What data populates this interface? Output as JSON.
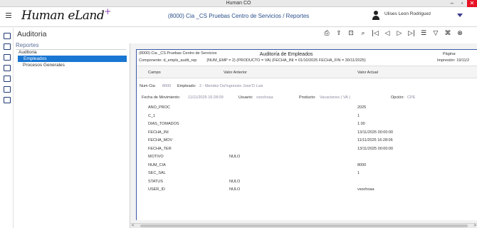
{
  "window": {
    "title": "Human CO",
    "min": "–",
    "max": "▫",
    "close": "✕"
  },
  "header": {
    "logo": "Human eLand",
    "logo_plus": "+",
    "company": "(8000) Cia _CS  Pruebas Centro de Servicios / Reportes",
    "user_name": "Ulises Leon Rodriguez"
  },
  "page": {
    "title": "Auditoria"
  },
  "toolbar": {
    "icons": [
      "printer-icon",
      "export-icon",
      "page-view-icon",
      "zoom-icon",
      "first-page-icon",
      "prev-page-icon",
      "next-page-icon",
      "last-page-icon",
      "list-icon",
      "filter-icon",
      "hierarchy-icon",
      "close-circle-icon"
    ],
    "glyphs": [
      "⎙",
      "⇪",
      "⊡",
      "⌕",
      "|◁",
      "◁",
      "▷",
      "▷|",
      "☰",
      "▽",
      "⌘",
      "⊗"
    ]
  },
  "nav": {
    "root": "Reportes",
    "group": "Auditoria",
    "items": [
      {
        "label": "Empleados",
        "selected": true
      },
      {
        "label": "Procesos Generales",
        "selected": false
      }
    ]
  },
  "report": {
    "company_line": "(8000) Cia _CS  Pruebas Centro de Servicios",
    "component_line": "Componente:  d_empls_audit_rep",
    "title": "Auditoría de Empleados",
    "params": "(NUM_EMP = 2)  (PRODUCTO = VA)  (FECHA_INI = 01/10/2025 FECHA_FIN = 30/11/2025)",
    "page_label": "Página:",
    "print_label": "Impresión: 19/11/2",
    "columns": {
      "campo": "Campo",
      "anterior": "Valor Anterior",
      "actual": "Valor Actual"
    },
    "info": {
      "num_cia_label": "Num Cia:",
      "num_cia_value": "8000",
      "empleado_label": "Empleado:",
      "empleado_value": "2 - Mendez Da'Ingressio Jose'O Luis",
      "fecha_mov_label": "Fecha de Movimiento:",
      "fecha_mov_value": "11/11/2025 16:28:09",
      "usuario_label": "Usuario:",
      "usuario_value": "vsochoaa",
      "producto_label": "Producto:",
      "producto_value": "Vacaciones  ( VA )",
      "opcion_label": "Opción:",
      "opcion_value": "CPE"
    },
    "rows": [
      {
        "campo": "ANO_PROC",
        "anterior": "",
        "actual": "2025"
      },
      {
        "campo": "C_1",
        "anterior": "",
        "actual": "1"
      },
      {
        "campo": "DIAS_TOMADOS",
        "anterior": "",
        "actual": "1.00"
      },
      {
        "campo": "FECHA_INI",
        "anterior": "",
        "actual": "13/11/2025 00:00:00"
      },
      {
        "campo": "FECHA_MOV",
        "anterior": "",
        "actual": "11/11/2025 16:28:06"
      },
      {
        "campo": "FECHA_TER",
        "anterior": "",
        "actual": "13/11/2025 00:00:00"
      },
      {
        "campo": "MOTIVO",
        "anterior": "NULO",
        "actual": ""
      },
      {
        "campo": "NUM_CIA",
        "anterior": "",
        "actual": "8000"
      },
      {
        "campo": "SEC_SAL",
        "anterior": "",
        "actual": "1"
      },
      {
        "campo": "STATUS",
        "anterior": "NULO",
        "actual": ""
      },
      {
        "campo": "USER_ID",
        "anterior": "NULO",
        "actual": "vsochoaa"
      }
    ]
  },
  "scrollbar": {
    "left": "<",
    "right": ">",
    "grip": "III"
  }
}
